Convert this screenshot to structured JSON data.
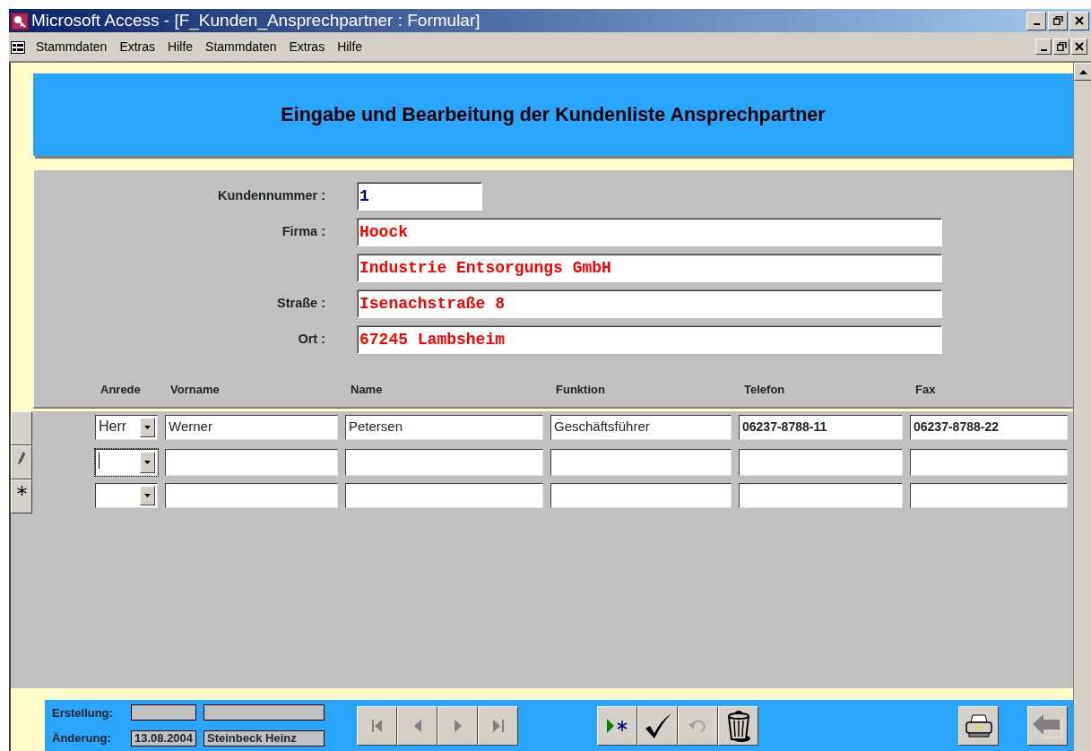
{
  "window": {
    "title": "Microsoft Access - [F_Kunden_Ansprechpartner : Formular]"
  },
  "menu": [
    "Stammdaten",
    "Extras",
    "Hilfe",
    "Stammdaten",
    "Extras",
    "Hilfe"
  ],
  "form": {
    "heading": "Eingabe und Bearbeitung der Kundenliste Ansprechpartner",
    "fields": [
      {
        "label": "Kundennummer :",
        "value": "1",
        "kind": "number"
      },
      {
        "label": "Firma :",
        "value": "Hoock",
        "kind": "text"
      },
      {
        "value": "Industrie Entsorgungs GmbH",
        "kind": "text"
      },
      {
        "label": "Straße :",
        "value": "Isenachstraße 8",
        "kind": "text"
      },
      {
        "label": "Ort :",
        "value": "67245 Lambsheim",
        "kind": "text"
      }
    ]
  },
  "columns": [
    "Anrede",
    "Vorname",
    "Name",
    "Funktion",
    "Telefon",
    "Fax"
  ],
  "rows": [
    {
      "kind": "current",
      "focused": false,
      "cells": [
        "Herr",
        "Werner",
        "Petersen",
        "Geschäftsführer",
        "06237-8788-11",
        "06237-8788-22"
      ]
    },
    {
      "kind": "editing",
      "focused": true,
      "cells": []
    },
    {
      "kind": "new",
      "focused": false,
      "cells": []
    }
  ],
  "footer": {
    "created": {
      "label": "Erstellung:"
    },
    "changed": {
      "label": "Änderung:",
      "date": "13.08.2004",
      "user": "Steinbeck Heinz"
    },
    "nav_buttons": [
      {
        "kind": "first",
        "disabled": true
      },
      {
        "kind": "previous",
        "disabled": true
      },
      {
        "kind": "next",
        "disabled": true
      },
      {
        "kind": "last",
        "disabled": true
      }
    ],
    "edit_buttons": [
      {
        "kind": "new",
        "disabled": false
      },
      {
        "kind": "save",
        "disabled": false
      },
      {
        "kind": "undo",
        "disabled": true
      },
      {
        "kind": "delete",
        "disabled": false
      }
    ],
    "right_buttons": [
      {
        "kind": "print",
        "disabled": false
      },
      {
        "kind": "close",
        "disabled": true
      }
    ]
  }
}
